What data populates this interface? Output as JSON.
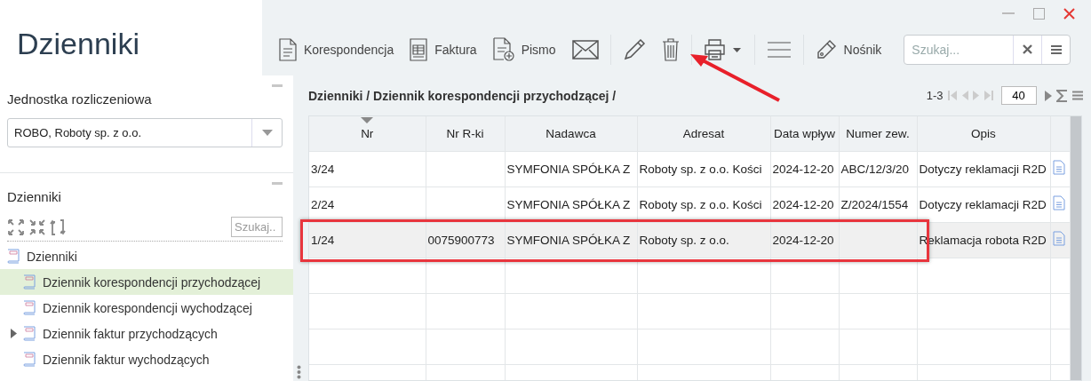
{
  "title": "Dzienniki",
  "toolbar": {
    "items": [
      {
        "kind": "document",
        "label": "Korespondencja"
      },
      {
        "kind": "invoice",
        "label": "Faktura"
      },
      {
        "kind": "letter",
        "label": "Pismo"
      },
      {
        "kind": "envelope"
      },
      {
        "kind": "pencil"
      },
      {
        "kind": "trash"
      },
      {
        "kind": "printer"
      },
      {
        "kind": "menu"
      },
      {
        "kind": "usb",
        "label": "Nośnik"
      }
    ],
    "search": {
      "placeholder": "Szukaj..."
    }
  },
  "unit": {
    "label": "Jednostka rozliczeniowa",
    "value": "ROBO, Roboty sp. z o.o."
  },
  "journals": {
    "title": "Dzienniki",
    "search": {
      "placeholder": "Szukaj.."
    },
    "tree": [
      {
        "label": "Dzienniki",
        "selected": false,
        "children": [
          {
            "label": "Dziennik korespondencji przychodzącej",
            "selected": true
          },
          {
            "label": "Dziennik korespondencji wychodzącej",
            "selected": false
          },
          {
            "label": "Dziennik faktur przychodzących",
            "selected": false,
            "expanded": false
          },
          {
            "label": "Dziennik faktur wychodzących",
            "selected": false
          }
        ]
      }
    ]
  },
  "breadcrumb": "Dzienniki / Dziennik korespondencji przychodzącej /",
  "pager": {
    "range": "1-3",
    "page_size": "40"
  },
  "table": {
    "columns": [
      {
        "label": "Nr",
        "sorted": true
      },
      {
        "label": "Nr R-ki",
        "sorted": false
      },
      {
        "label": "Nadawca",
        "sorted": false
      },
      {
        "label": "Adresat",
        "sorted": false
      },
      {
        "label": "Data wpływ",
        "sorted": false
      },
      {
        "label": "Numer zew.",
        "sorted": false
      },
      {
        "label": "Opis",
        "sorted": false
      }
    ],
    "rows": [
      {
        "selected": false,
        "cells": [
          "3/24",
          "",
          "SYMFONIA SPÓŁKA Z",
          "Roboty sp. z o.o. Kości",
          "2024-12-20",
          "ABC/12/3/20",
          "Dotyczy reklamacji R2D"
        ]
      },
      {
        "selected": false,
        "cells": [
          "2/24",
          "",
          "SYMFONIA SPÓŁKA Z",
          "Roboty sp. z o.o. Kości",
          "2024-12-20",
          "Z/2024/1554",
          "Dotyczy reklamacji R2D"
        ]
      },
      {
        "selected": true,
        "cells": [
          "1/24",
          "0075900773",
          "SYMFONIA SPÓŁKA Z",
          "Roboty sp. z o.o.",
          "2024-12-20",
          "",
          "Reklamacja robota R2D"
        ]
      }
    ]
  },
  "annotations": [
    {
      "kind": "box"
    },
    {
      "kind": "arrow"
    }
  ]
}
